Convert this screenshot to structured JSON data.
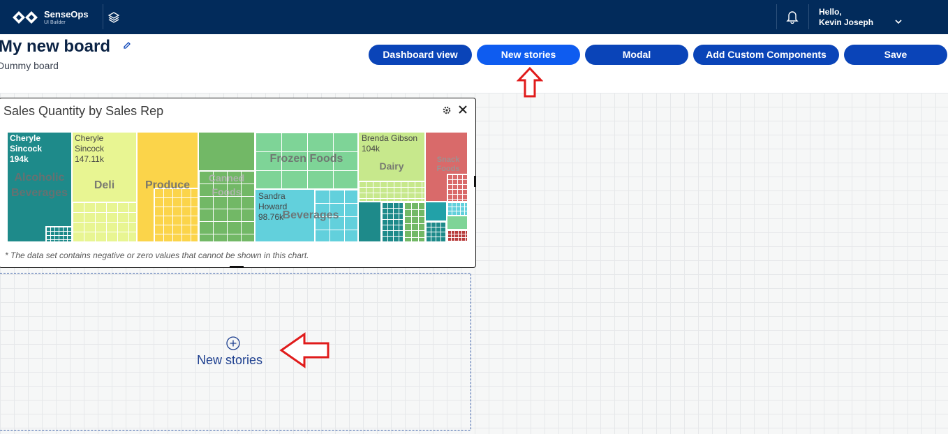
{
  "app": {
    "brand": "SenseOps",
    "brand_sub": "UI Builder"
  },
  "user": {
    "greeting": "Hello,",
    "name": "Kevin Joseph"
  },
  "board": {
    "title": "My new board",
    "subtitle": "Dummy board"
  },
  "toolbar": {
    "buttons": [
      {
        "label": "Dashboard view"
      },
      {
        "label": "New stories",
        "active": true
      },
      {
        "label": "Modal"
      },
      {
        "label": "Add Custom Components"
      },
      {
        "label": "Save"
      }
    ]
  },
  "widget": {
    "title": "Sales Quantity by Sales Rep",
    "note": "* The data set contains negative or zero values that cannot be shown in this chart."
  },
  "chart_data": {
    "type": "treemap",
    "title": "Sales Quantity by Sales Rep",
    "categories": [
      {
        "name": "Alcoholic Beverages",
        "color": "#1e8a8a",
        "top_rep": "Cheryle Sincock",
        "top_value": "194k"
      },
      {
        "name": "Deli",
        "color": "#e8f592",
        "top_rep": "Cheryle Sincock",
        "top_value": "147.11k"
      },
      {
        "name": "Produce",
        "color": "#fbd44a",
        "top_rep": "",
        "top_value": ""
      },
      {
        "name": "Canned Foods",
        "color": "#72b866",
        "top_rep": "",
        "top_value": ""
      },
      {
        "name": "Frozen Foods",
        "color": "#7ed497",
        "top_rep": "",
        "top_value": ""
      },
      {
        "name": "Beverages",
        "color": "#62d0dc",
        "top_rep": "Sandra Howard",
        "top_value": "98.76k"
      },
      {
        "name": "Dairy",
        "color": "#c7e88c",
        "top_rep": "Brenda Gibson",
        "top_value": "104k"
      },
      {
        "name": "Snack Foods",
        "color": "#d96a6a",
        "top_rep": "",
        "top_value": ""
      }
    ]
  },
  "drop_zone": {
    "label": "New stories"
  },
  "icons": {
    "logo": "senseops-logo",
    "layers": "layers-icon",
    "bell": "bell-icon",
    "chevron": "chevron-down-icon",
    "edit": "pencil-icon",
    "gear": "gear-icon",
    "close": "close-icon",
    "plus": "plus-circle-icon"
  },
  "colors": {
    "header": "#022b5b",
    "button": "#0a44b8",
    "button_active": "#0e5cf0",
    "annotation": "#e01b1b"
  }
}
